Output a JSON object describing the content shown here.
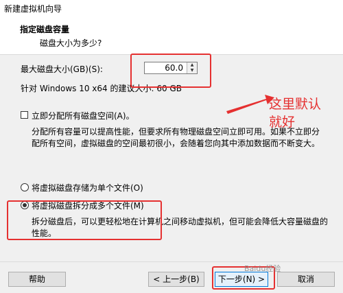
{
  "window": {
    "title": "新建虚拟机向导"
  },
  "header": {
    "title": "指定磁盘容量",
    "subtitle": "磁盘大小为多少?"
  },
  "disk": {
    "max_size_label": "最大磁盘大小(GB)(S):",
    "max_size_value": "60.0",
    "recommend_text": "针对 Windows 10 x64 的建议大小: 60 GB"
  },
  "allocate": {
    "label": "立即分配所有磁盘空间(A)。",
    "checked": false,
    "description": "分配所有容量可以提高性能，但要求所有物理磁盘空间立即可用。如果不立即分配所有空间，虚拟磁盘的空间最初很小，会随着您向其中添加数据而不断变大。"
  },
  "options": [
    {
      "label": "将虚拟磁盘存储为单个文件(O)",
      "selected": false
    },
    {
      "label": "将虚拟磁盘拆分成多个文件(M)",
      "selected": true
    }
  ],
  "split_description": "拆分磁盘后，可以更轻松地在计算机之间移动虚拟机，但可能会降低大容量磁盘的性能。",
  "buttons": {
    "help": "帮助",
    "back": "< 上一步(B)",
    "next": "下一步(N) >",
    "cancel": "取消"
  },
  "annotation": {
    "line1": "这里默认",
    "line2": "就好",
    "color": "#e53030"
  },
  "watermark": "Baidu经验"
}
